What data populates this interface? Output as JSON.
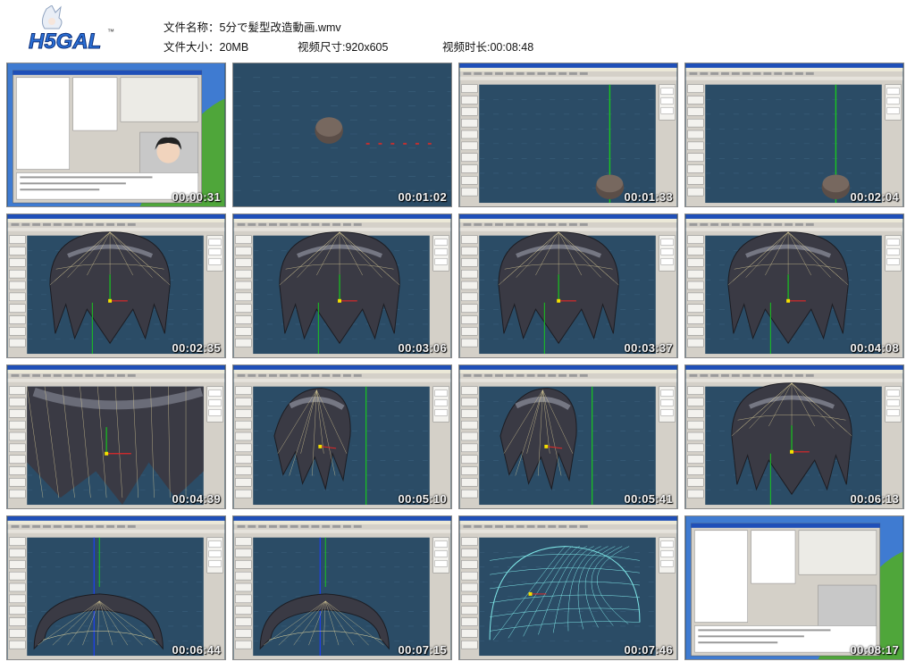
{
  "file_info": {
    "name_label": "文件名称：",
    "name_value": "5分で髪型改造動画.wmv",
    "size_label": "文件大小：",
    "size_value": "20MB",
    "dims_label": "视频尺寸: ",
    "dims_value": "920x605",
    "duration_label": "视频时长: ",
    "duration_value": "00:08:48"
  },
  "logo": {
    "text": "H5GAL",
    "tm": "™"
  },
  "thumbnails": [
    {
      "time": "00:00:31",
      "scene": "desktop"
    },
    {
      "time": "00:01:02",
      "scene": "empty3d"
    },
    {
      "time": "00:01:33",
      "scene": "small-app"
    },
    {
      "time": "00:02:04",
      "scene": "small-app"
    },
    {
      "time": "00:02:35",
      "scene": "hair-full"
    },
    {
      "time": "00:03:06",
      "scene": "hair-full"
    },
    {
      "time": "00:03:37",
      "scene": "hair-full"
    },
    {
      "time": "00:04:08",
      "scene": "hair-full"
    },
    {
      "time": "00:04:39",
      "scene": "hair-zoom"
    },
    {
      "time": "00:05:10",
      "scene": "hair-side"
    },
    {
      "time": "00:05:41",
      "scene": "hair-side"
    },
    {
      "time": "00:06:13",
      "scene": "hair-full"
    },
    {
      "time": "00:06:44",
      "scene": "hair-arc"
    },
    {
      "time": "00:07:15",
      "scene": "hair-arc"
    },
    {
      "time": "00:07:46",
      "scene": "wire"
    },
    {
      "time": "00:08:17",
      "scene": "desktop-end"
    }
  ],
  "colors": {
    "viewport": "#2b4c66",
    "window": "#d4d0c8",
    "titlebar": "#1f4fb8",
    "hair": "#3a3a44",
    "wire": "#e8d9a0",
    "cyanwire": "#7fe8e8"
  }
}
